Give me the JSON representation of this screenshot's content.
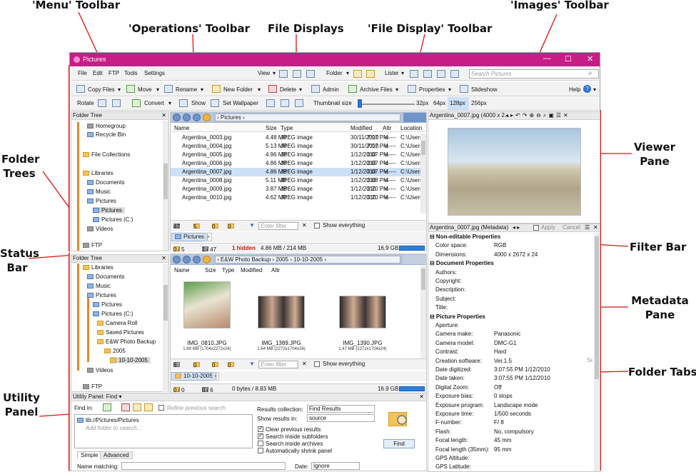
{
  "callouts": {
    "menu_toolbar": "'Menu' Toolbar",
    "images_toolbar": "'Images' Toolbar",
    "operations_toolbar": "'Operations' Toolbar",
    "file_displays": "File Displays",
    "file_display_toolbar": "'File Display' Toolbar",
    "folder_trees_1": "Folder",
    "folder_trees_2": "Trees",
    "viewer_pane_1": "Viewer",
    "viewer_pane_2": "Pane",
    "status_bar_1": "Status",
    "status_bar_2": "Bar",
    "filter_bar": "Filter Bar",
    "metadata_pane_1": "Metadata",
    "metadata_pane_2": "Pane",
    "folder_tabs": "Folder Tabs",
    "utility_panel_1": "Utility",
    "utility_panel_2": "Panel"
  },
  "window": {
    "title": "Pictures",
    "minimize": "—",
    "maximize": "☐",
    "close": "✕"
  },
  "menu": {
    "file": "File",
    "edit": "Edit",
    "ftp": "FTP",
    "tools": "Tools",
    "settings": "Settings",
    "view": "View",
    "folder": "Folder",
    "lister": "Lister",
    "search_placeholder": "Search Pictures"
  },
  "operations": {
    "copy_files": "Copy Files",
    "move": "Move",
    "rename": "Rename",
    "new_folder": "New Folder",
    "delete": "Delete",
    "admin": "Admin",
    "archive_files": "Archive Files",
    "properties": "Properties",
    "slideshow": "Slideshow",
    "help": "Help"
  },
  "images": {
    "rotate": "Rotate",
    "convert": "Convert",
    "show": "Show",
    "set_wallpaper": "Set Wallpaper",
    "thumbnail_size": "Thumbnail size",
    "sizes": [
      "32px",
      "64px",
      "128px",
      "256px"
    ],
    "selected_size": "128px"
  },
  "tree1": {
    "header": "Folder Tree",
    "items": [
      "Homegroup",
      "Recycle Bin",
      "File Collections",
      "Libraries",
      "Documents",
      "Music",
      "Pictures",
      "Pictures",
      "Pictures (C:)",
      "Videos",
      "FTP"
    ]
  },
  "tree2": {
    "header": "Folder Tree",
    "items": [
      "Libraries",
      "Documents",
      "Music",
      "Pictures",
      "Pictures",
      "Pictures (C:)",
      "Camera Roll",
      "Saved Pictures",
      "E&W Photo Backup",
      "2005",
      "10-10-2005",
      "Videos",
      "FTP"
    ]
  },
  "display1": {
    "path": "Pictures",
    "columns": [
      "Name",
      "Size",
      "Type",
      "Modified",
      "Attr",
      "Location"
    ],
    "rows": [
      [
        "Argentina_0003.jpg",
        "4.48 MB",
        "JPEG image",
        "30/11/2010",
        "7:07 PM",
        "-a----",
        "C:\\Users"
      ],
      [
        "Argentina_0004.jpg",
        "5.13 MB",
        "JPEG image",
        "30/11/2010",
        "7:07 PM",
        "-a----",
        "C:\\Users"
      ],
      [
        "Argentina_0005.jpg",
        "4.96 MB",
        "JPEG image",
        "1/12/2010",
        "3:07 PM",
        "-a----",
        "C:\\Users"
      ],
      [
        "Argentina_0006.jpg",
        "4.86 MB",
        "JPEG image",
        "1/12/2010",
        "3:07 PM",
        "-a----",
        "C:\\Users"
      ],
      [
        "Argentina_0007.jpg",
        "4.86 MB",
        "JPEG image",
        "1/12/2010",
        "3:07 PM",
        "-a----",
        "C:\\Users"
      ],
      [
        "Argentina_0008.jpg",
        "5.11 MB",
        "JPEG image",
        "1/12/2010",
        "3:08 PM",
        "-a----",
        "C:\\Users"
      ],
      [
        "Argentina_0009.jpg",
        "3.87 MB",
        "JPEG image",
        "1/12/2010",
        "3:20 PM",
        "-a----",
        "C:\\Users"
      ],
      [
        "Argentina_0010.jpg",
        "4.62 MB",
        "JPEG image",
        "1/12/2010",
        "3:20 PM",
        "-a----",
        "C:\\Users"
      ]
    ],
    "filter": {
      "c1": "47",
      "c2": "5",
      "c3": "0",
      "c4": "0",
      "placeholder": "Enter filter",
      "show_everything": "Show everything"
    },
    "tab": "Pictures",
    "status": {
      "a": "0 / 5",
      "b": "1 / 47",
      "hidden": "1 hidden",
      "size": "4.86 MB / 214 MB",
      "free": "16.9 GB"
    }
  },
  "display2": {
    "path": [
      "E&W Photo Backup",
      "2005",
      "10-10-2005"
    ],
    "columns": [
      "Name",
      "Size",
      "Type",
      "Modified",
      "Attr"
    ],
    "thumbs": [
      {
        "name": "IMG_0810.JPG",
        "info": "1.69 MB (1704x2272x24)"
      },
      {
        "name": "IMG_1389.JPG",
        "info": "1.64 MB (2272x1704x24)"
      },
      {
        "name": "IMG_1390.JPG",
        "info": "1.47 MB (2272x1704x24)"
      }
    ],
    "filter": {
      "c1": "6",
      "c2": "0",
      "c3": "0",
      "c4": "0",
      "placeholder": "Enter filter",
      "show_everything": "Show everything"
    },
    "tab": "10-10-2005",
    "status": {
      "a": "0 / 0",
      "b": "0 / 6",
      "size": "0 bytes / 8.83 MB",
      "free": "16.9 GB"
    }
  },
  "viewer": {
    "title": "Argentina_0007.jpg (4000 x 2..."
  },
  "metadata": {
    "title": "Argentina_0007.jpg (Metadata)",
    "apply": "Apply",
    "cancel": "Cancel",
    "sections": [
      {
        "name": "Non-editable Properties",
        "rows": [
          [
            "Color space:",
            "RGB"
          ],
          [
            "Dimensions:",
            "4000 x 2672 x 24"
          ]
        ]
      },
      {
        "name": "Document Properties",
        "rows": [
          [
            "Authors:",
            ""
          ],
          [
            "Copyright:",
            ""
          ],
          [
            "Description:",
            ""
          ],
          [
            "Subject:",
            ""
          ],
          [
            "Title:",
            ""
          ]
        ]
      },
      {
        "name": "Picture Properties",
        "rows": [
          [
            "Aperture:",
            ""
          ],
          [
            "Camera make:",
            "Panasonic"
          ],
          [
            "Camera model:",
            "DMC-G1"
          ],
          [
            "Contrast:",
            "Hard"
          ],
          [
            "Creation software:",
            "Ver.1.5"
          ],
          [
            "Date digitized:",
            "3:07:55 PM        1/12/2010"
          ],
          [
            "Date taken:",
            "3:07:55 PM        1/12/2010"
          ],
          [
            "Digital Zoom:",
            "Off"
          ],
          [
            "Exposure bias:",
            "0      stops"
          ],
          [
            "Exposure program:",
            "Landscape mode"
          ],
          [
            "Exposure time:",
            "1/500       seconds"
          ],
          [
            "F-number:",
            "F/  8"
          ],
          [
            "Flash:",
            "No, compulsory"
          ],
          [
            "Focal length:",
            "45       mm"
          ],
          [
            "Focal length (35mm):",
            "95       mm"
          ],
          [
            "GPS Altitude:",
            ""
          ],
          [
            "GPS Latitude:",
            ""
          ]
        ]
      }
    ],
    "sel": "Sel"
  },
  "utility": {
    "header": "Utility Panel:",
    "find": "Find",
    "find_in": "Find in:",
    "refine": "Refine previous search",
    "location": "lib://Pictures/Pictures",
    "add_folder": "Add folder to search...",
    "results_collection_label": "Results collection:",
    "results_collection": "Find Results",
    "show_results_label": "Show results in:",
    "show_results": "source",
    "options": [
      "Clear previous results",
      "Search inside subfolders",
      "Search inside archives",
      "Automatically shrink panel"
    ],
    "find_button": "Find",
    "tab_simple": "Simple",
    "tab_advanced": "Advanced",
    "name_matching": "Name matching:",
    "date": "Date:",
    "date_value": "Ignore"
  }
}
